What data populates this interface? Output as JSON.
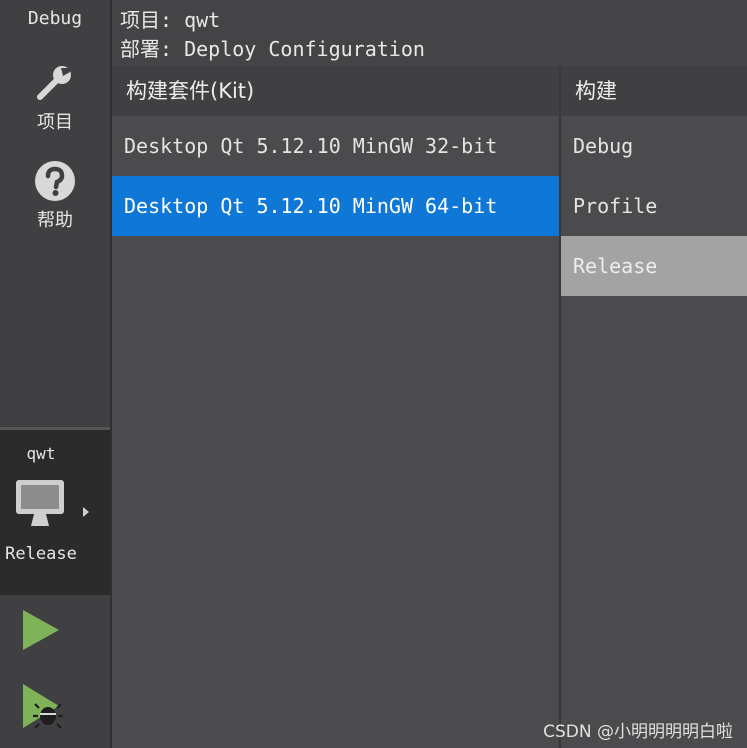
{
  "sidebar": {
    "modes": [
      {
        "label": "Debug",
        "icon": "debug-mode-icon"
      },
      {
        "label": "项目",
        "icon": "wrench-icon"
      },
      {
        "label": "帮助",
        "icon": "help-icon"
      }
    ],
    "target": {
      "project": "qwt",
      "config": "Release",
      "icon": "monitor-icon"
    },
    "run_icon": "play-icon",
    "debug_run_icon": "debug-play-icon"
  },
  "header": {
    "project_line": "项目: qwt",
    "deploy_line": "部署: Deploy Configuration"
  },
  "kits": {
    "header": "构建套件(Kit)",
    "items": [
      "Desktop Qt 5.12.10 MinGW 32-bit",
      "Desktop Qt 5.12.10 MinGW 64-bit"
    ],
    "selected_index": 1
  },
  "builds": {
    "header": "构建",
    "items": [
      "Debug",
      "Profile",
      "Release"
    ],
    "selected_index": 2
  },
  "watermark": "CSDN @小明明明明白啦",
  "colors": {
    "selection_blue": "#0f78d7",
    "selection_gray": "#a3a3a3",
    "run_green": "#7fb35a"
  }
}
